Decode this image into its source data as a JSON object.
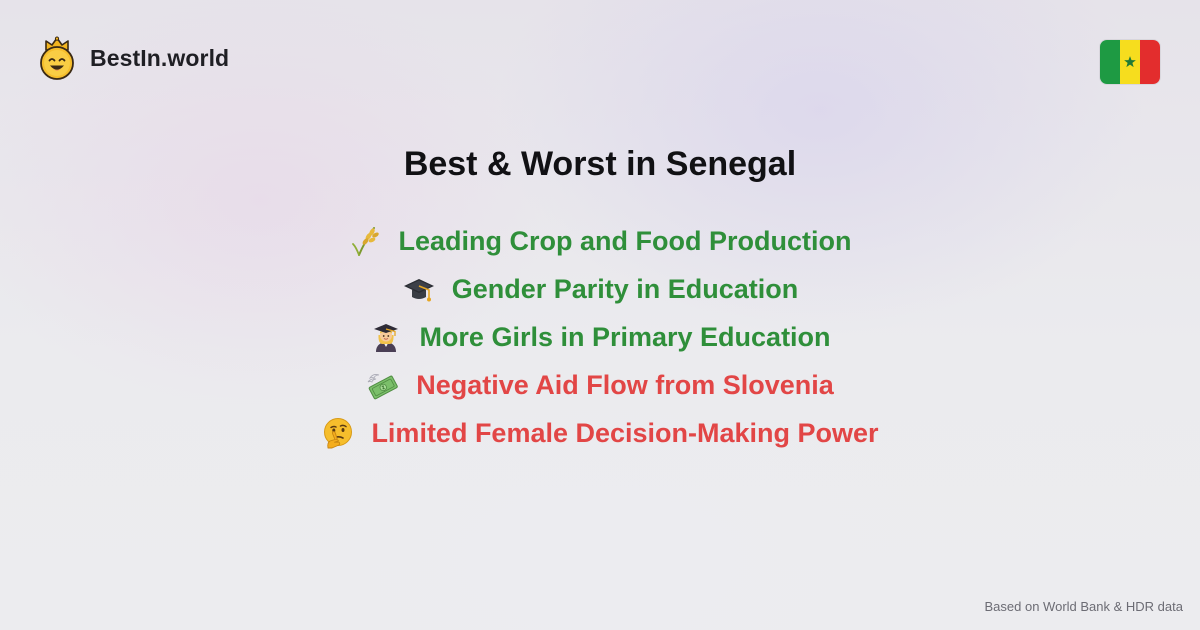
{
  "brand": {
    "name": "BestIn.world",
    "logo_icon": "crowned-smiley-icon"
  },
  "flag": {
    "country": "Senegal",
    "icon": "senegal-flag-icon",
    "colors": [
      "#1e9a43",
      "#f6dd1e",
      "#e32d2d"
    ],
    "star_color": "#1e7a36"
  },
  "page_title": "Best & Worst in Senegal",
  "colors": {
    "best": "#2f8f3a",
    "worst": "#e24646",
    "title": "#111114"
  },
  "items": [
    {
      "label": "Leading Crop and Food Production",
      "kind": "best",
      "icon": "rice-plant-icon"
    },
    {
      "label": "Gender Parity in Education",
      "kind": "best",
      "icon": "graduation-cap-icon"
    },
    {
      "label": "More Girls in Primary Education",
      "kind": "best",
      "icon": "female-student-icon"
    },
    {
      "label": "Negative Aid Flow from Slovenia",
      "kind": "worst",
      "icon": "money-with-wings-icon"
    },
    {
      "label": "Limited Female Decision-Making Power",
      "kind": "worst",
      "icon": "thinking-face-icon"
    }
  ],
  "footer": {
    "source": "Based on World Bank & HDR data"
  }
}
